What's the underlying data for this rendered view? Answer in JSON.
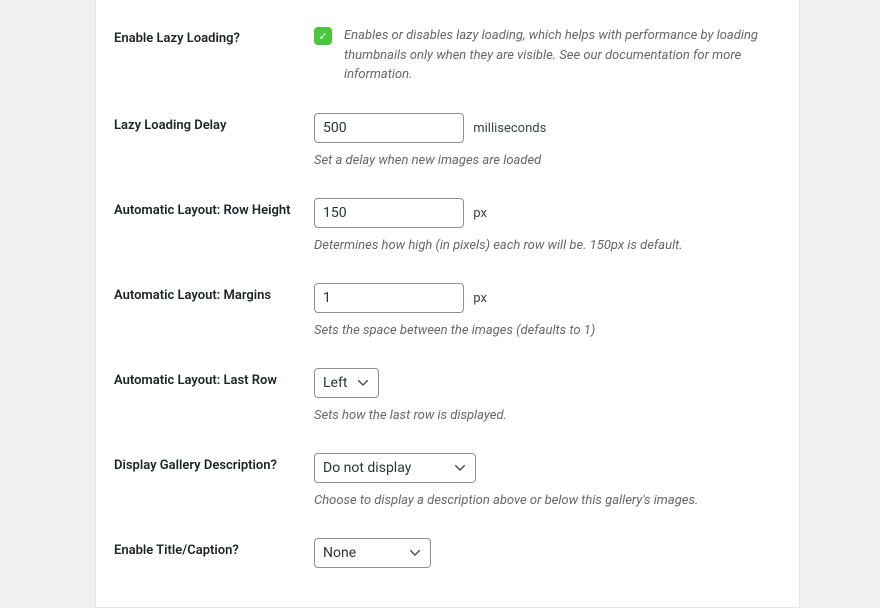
{
  "fields": {
    "lazy_loading": {
      "label": "Enable Lazy Loading?",
      "checked": true,
      "description": "Enables or disables lazy loading, which helps with performance by loading thumbnails only when they are visible. See our documentation for more information."
    },
    "lazy_delay": {
      "label": "Lazy Loading Delay",
      "value": "500",
      "unit": "milliseconds",
      "description": "Set a delay when new images are loaded"
    },
    "row_height": {
      "label": "Automatic Layout: Row Height",
      "value": "150",
      "unit": "px",
      "description": "Determines how high (in pixels) each row will be. 150px is default."
    },
    "margins": {
      "label": "Automatic Layout: Margins",
      "value": "1",
      "unit": "px",
      "description": "Sets the space between the images (defaults to 1)"
    },
    "last_row": {
      "label": "Automatic Layout: Last Row",
      "value": "Left",
      "description": "Sets how the last row is displayed."
    },
    "display_desc": {
      "label": "Display Gallery Description?",
      "value": "Do not display",
      "description": "Choose to display a description above or below this gallery's images."
    },
    "title_caption": {
      "label": "Enable Title/Caption?",
      "value": "None"
    }
  }
}
